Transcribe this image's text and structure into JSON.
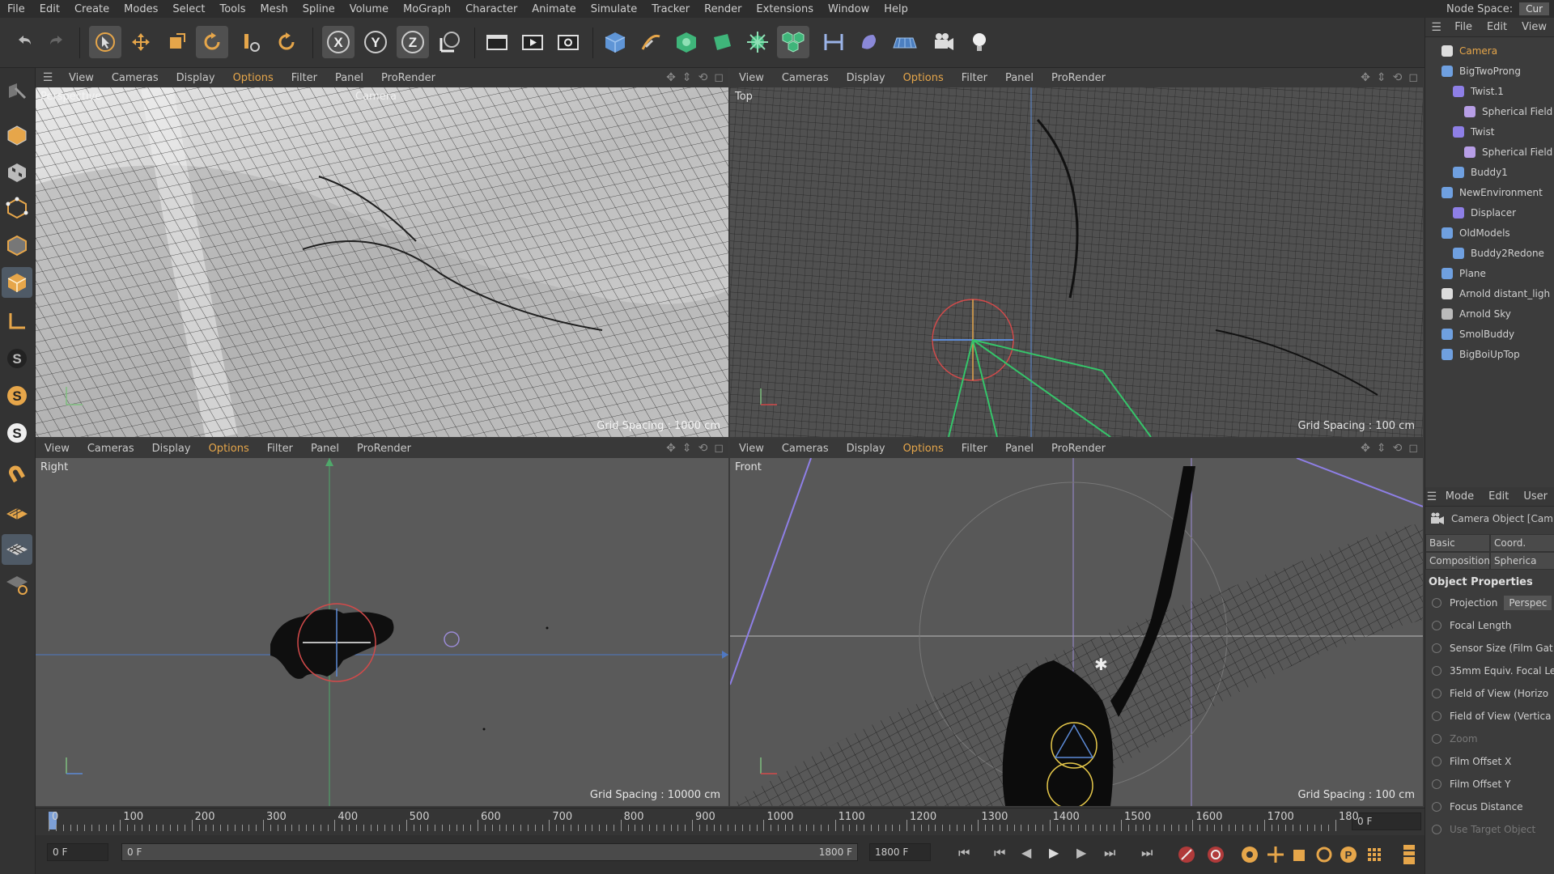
{
  "menubar": {
    "items": [
      "File",
      "Edit",
      "Create",
      "Modes",
      "Select",
      "Tools",
      "Mesh",
      "Spline",
      "Volume",
      "MoGraph",
      "Character",
      "Animate",
      "Simulate",
      "Tracker",
      "Render",
      "Extensions",
      "Window",
      "Help"
    ],
    "node_space_label": "Node Space:",
    "node_space_value": "Cur"
  },
  "toolbar": {
    "icons": [
      "undo-icon",
      "redo-icon",
      "select-icon",
      "move-icon",
      "scale-icon",
      "rotate-icon",
      "live-select-icon",
      "recent-tool-icon",
      "x-axis-icon",
      "y-axis-icon",
      "z-axis-icon",
      "world-coord-icon",
      "render-region-icon",
      "render-view-icon",
      "render-settings-icon",
      "cube-icon",
      "pen-icon",
      "subdivision-icon",
      "extrude-icon",
      "cloner-icon",
      "mograph-icon",
      "deformer-icon",
      "field-icon",
      "floor-icon",
      "camera-icon",
      "light-icon"
    ]
  },
  "lefttools": {
    "icons": [
      "make-editable-icon",
      "model-icon",
      "texture-icon",
      "points-icon",
      "edges-icon",
      "polygons-icon",
      "axis-icon",
      "snap-icon",
      "snap-orange-icon",
      "snap-white-icon",
      "magnet-icon",
      "workplane-icon",
      "grid-icon",
      "texture-tag-icon"
    ]
  },
  "viewports": {
    "menu": [
      "View",
      "Cameras",
      "Display",
      "Options",
      "Filter",
      "Panel",
      "ProRender"
    ],
    "highlight": "Options",
    "tl": {
      "label": "Perspective",
      "camera_label": "Camera",
      "grid_spacing": "Grid Spacing : 1000 cm"
    },
    "tr": {
      "label": "Top",
      "grid_spacing": "Grid Spacing : 100 cm"
    },
    "bl": {
      "label": "Right",
      "grid_spacing": "Grid Spacing : 10000 cm"
    },
    "br": {
      "label": "Front",
      "grid_spacing": "Grid Spacing : 100 cm"
    }
  },
  "timeline": {
    "ticks": [
      "0",
      "100",
      "200",
      "300",
      "400",
      "500",
      "600",
      "700",
      "800",
      "900",
      "1000",
      "1100",
      "1200",
      "1300",
      "1400",
      "1500",
      "1600",
      "1700",
      "180"
    ],
    "current_frame": "0 F"
  },
  "playbar": {
    "start_field": "0 F",
    "range_start": "0 F",
    "range_end": "1800 F",
    "end_field": "1800 F"
  },
  "object_manager": {
    "menu": [
      "File",
      "Edit",
      "View"
    ],
    "objects": [
      {
        "name": "Camera",
        "selected": true
      },
      {
        "name": "BigTwoProng"
      },
      {
        "name": "Twist.1"
      },
      {
        "name": "Spherical Field"
      },
      {
        "name": "Twist"
      },
      {
        "name": "Spherical Field"
      },
      {
        "name": "Buddy1"
      },
      {
        "name": "NewEnvironment"
      },
      {
        "name": "Displacer"
      },
      {
        "name": "OldModels"
      },
      {
        "name": "Buddy2Redone"
      },
      {
        "name": "Plane"
      },
      {
        "name": "Arnold distant_ligh"
      },
      {
        "name": "Arnold Sky"
      },
      {
        "name": "SmolBuddy"
      },
      {
        "name": "BigBoiUpTop"
      }
    ]
  },
  "attributes": {
    "menu": [
      "Mode",
      "Edit",
      "User"
    ],
    "object_title": "Camera Object [Cam",
    "tabs_row1": [
      "Basic",
      "Coord."
    ],
    "tabs_row2": [
      "Composition",
      "Spherica"
    ],
    "section_title": "Object Properties",
    "projection_label": "Projection",
    "projection_value": "Perspec",
    "rows": [
      {
        "label": "Focal Length",
        "dim": false
      },
      {
        "label": "Sensor Size (Film Gat",
        "dim": false
      },
      {
        "label": "35mm Equiv. Focal Leng",
        "dim": false
      },
      {
        "label": "Field of View (Horizo",
        "dim": false
      },
      {
        "label": "Field of View (Vertica",
        "dim": false
      },
      {
        "label": "Zoom",
        "dim": true
      },
      {
        "label": "Film Offset X",
        "dim": false
      },
      {
        "label": "Film Offset Y",
        "dim": false
      },
      {
        "label": "Focus Distance",
        "dim": false
      },
      {
        "label": "Use Target Object",
        "dim": true
      }
    ]
  }
}
